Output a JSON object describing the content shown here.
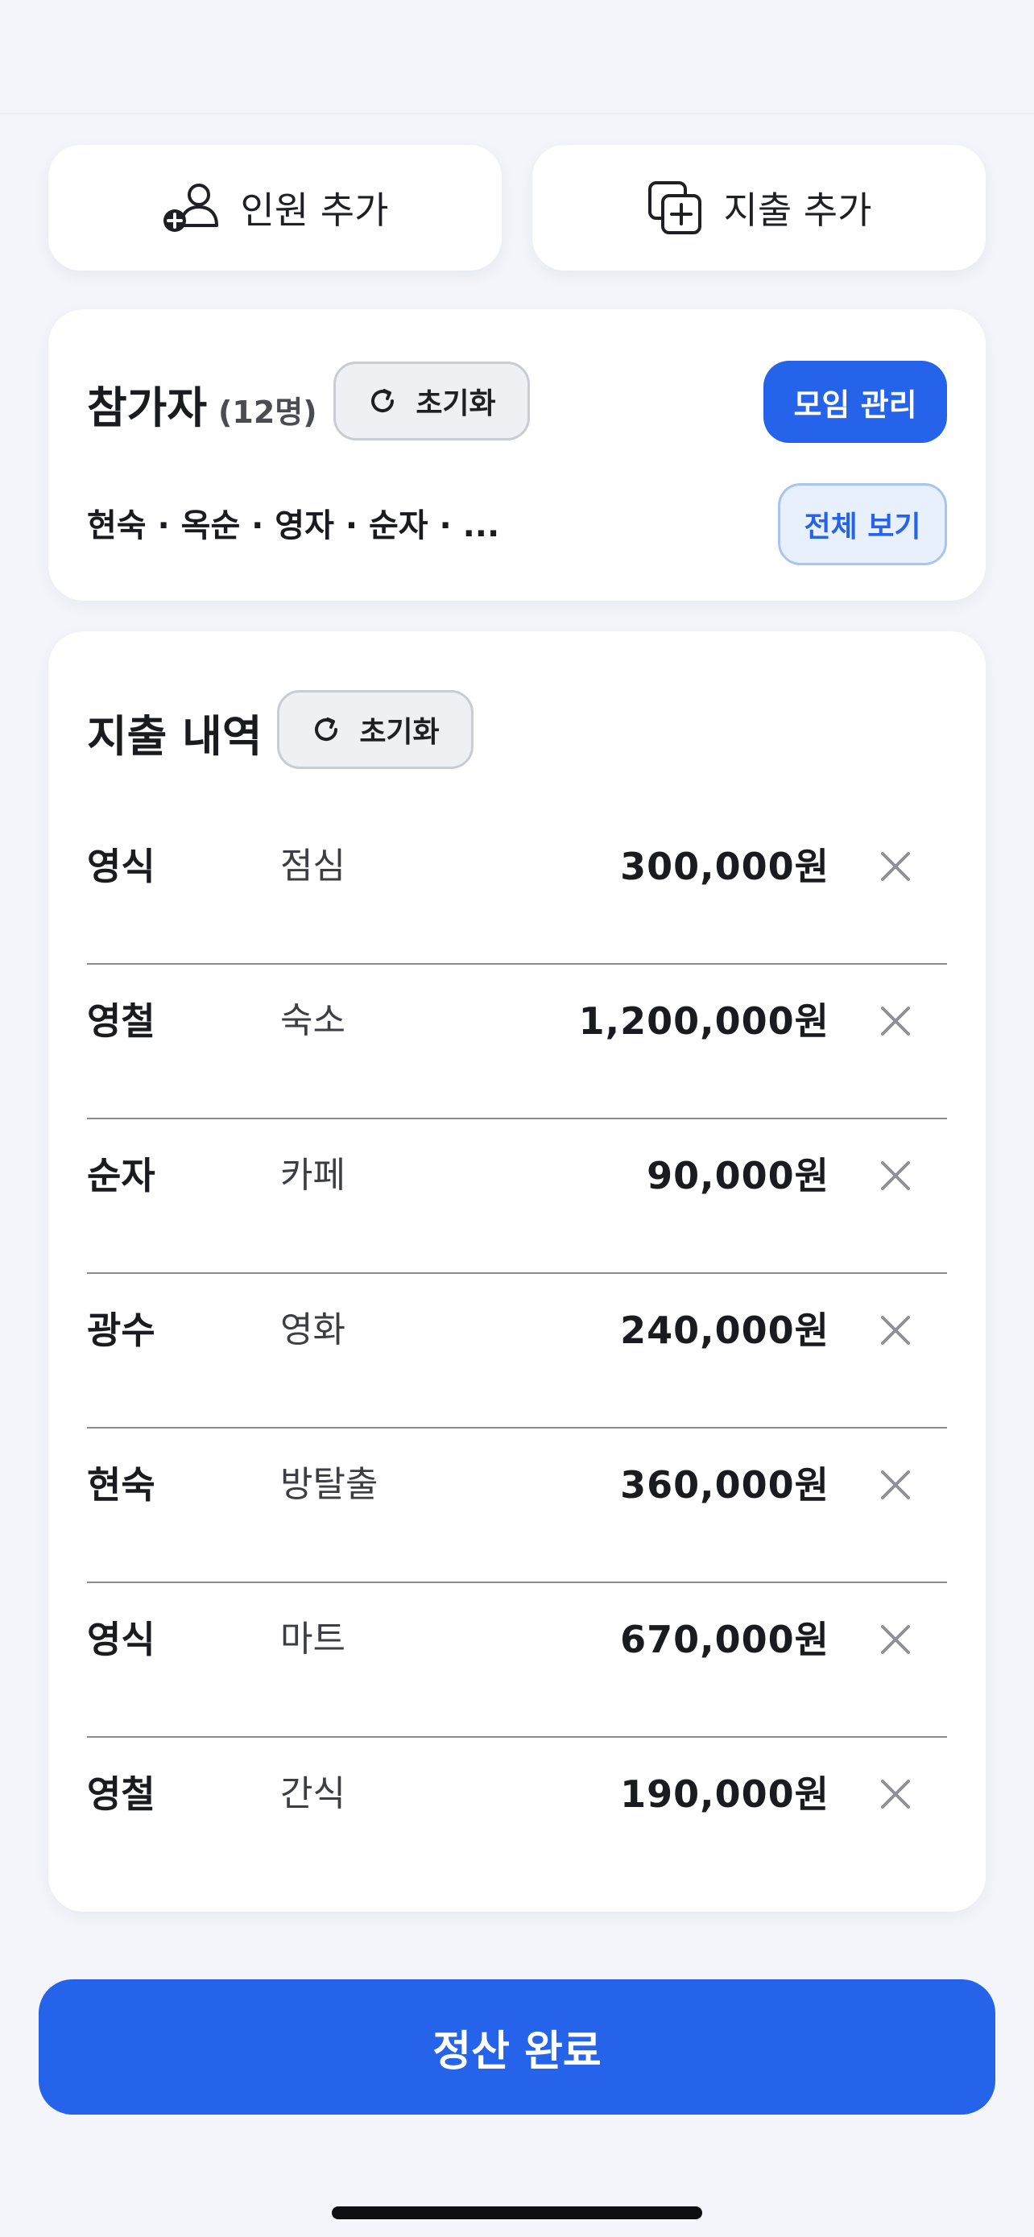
{
  "actions": {
    "add_member": {
      "label": "인원 추가",
      "icon": "person-add-icon"
    },
    "add_expense": {
      "label": "지출 추가",
      "icon": "copy-plus-icon"
    }
  },
  "participants": {
    "title": "참가자",
    "count": "(12명)",
    "reset_label": "초기화",
    "manage_label": "모임 관리",
    "list_text": "현숙 · 옥순 · 영자 · 순자 · ...",
    "view_all_label": "전체 보기"
  },
  "expenses": {
    "title": "지출 내역",
    "reset_label": "초기화",
    "items": [
      {
        "payer": "영식",
        "description": "점심",
        "amount": "300,000원"
      },
      {
        "payer": "영철",
        "description": "숙소",
        "amount": "1,200,000원"
      },
      {
        "payer": "순자",
        "description": "카페",
        "amount": "90,000원"
      },
      {
        "payer": "광수",
        "description": "영화",
        "amount": "240,000원"
      },
      {
        "payer": "현숙",
        "description": "방탈출",
        "amount": "360,000원"
      },
      {
        "payer": "영식",
        "description": "마트",
        "amount": "670,000원"
      },
      {
        "payer": "영철",
        "description": "간식",
        "amount": "190,000원"
      }
    ]
  },
  "footer": {
    "complete_label": "정산 완료"
  },
  "colors": {
    "accent": "#2563eb",
    "background": "#f3f5fa",
    "card": "#ffffff"
  }
}
